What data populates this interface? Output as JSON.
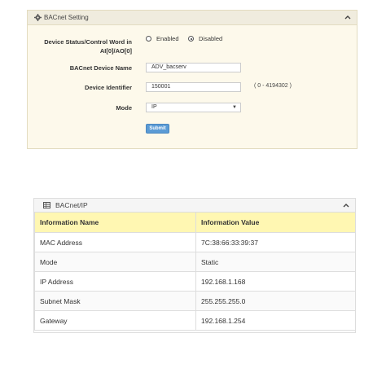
{
  "bacnet_setting": {
    "title": "BACnet Setting",
    "fields": {
      "status_control_label_line1": "Device Status/Control Word in",
      "status_control_label_line2": "AI[0]/AO[0]",
      "option_enabled": "Enabled",
      "option_disabled": "Disabled",
      "selected_option": "Disabled",
      "device_name_label": "BACnet Device Name",
      "device_name_value": "ADV_bacserv",
      "device_identifier_label": "Device Identifier",
      "device_identifier_value": "150001",
      "device_identifier_range": "( 0 - 4194302 )",
      "mode_label": "Mode",
      "mode_value": "IP"
    },
    "submit_label": "Submit"
  },
  "bacnet_ip": {
    "title": "BACnet/IP",
    "columns": [
      "Information Name",
      "Information Value"
    ],
    "rows": [
      {
        "name": "MAC Address",
        "value": "7C:38:66:33:39:37"
      },
      {
        "name": "Mode",
        "value": "Static"
      },
      {
        "name": "IP Address",
        "value": "192.168.1.168"
      },
      {
        "name": "Subnet Mask",
        "value": "255.255.255.0"
      },
      {
        "name": "Gateway",
        "value": "192.168.1.254"
      }
    ]
  },
  "colors": {
    "setting_panel_bg": "#fdf9eb",
    "table_header_bg": "#fff7b2",
    "submit_button": "#5b9bd5"
  },
  "icons": {
    "setting_header": "gear-icon",
    "ip_header": "table-icon",
    "collapse": "chevron-up-icon",
    "dropdown": "caret-down-icon"
  }
}
